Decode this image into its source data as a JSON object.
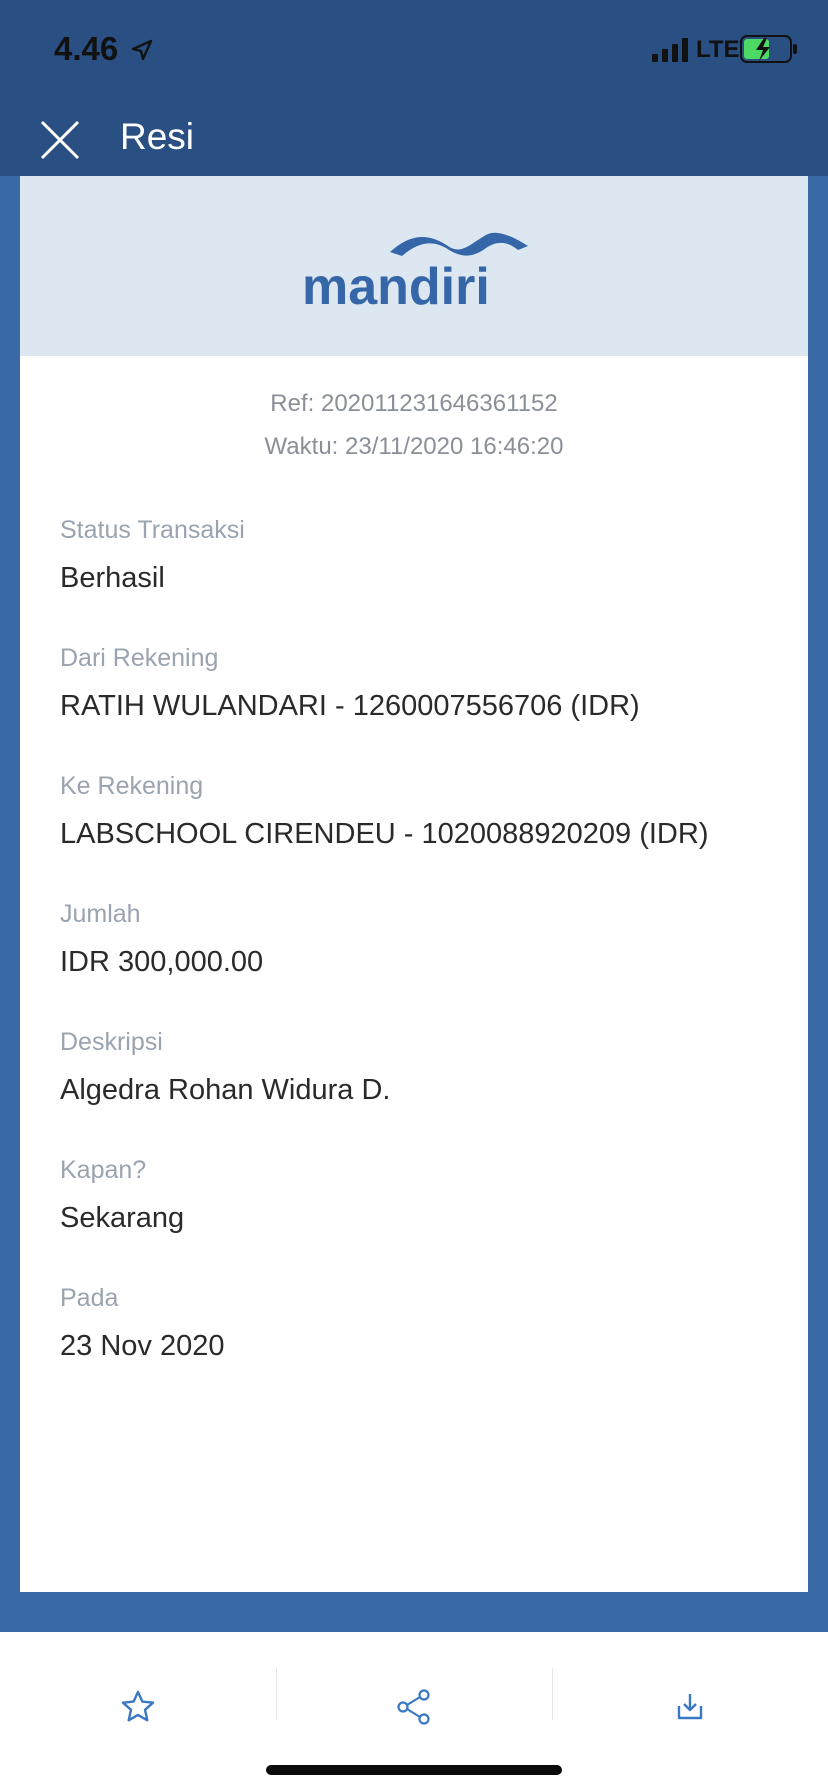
{
  "status_bar": {
    "time": "4.46",
    "network": "LTE",
    "icons": [
      "location-arrow-icon",
      "signal-icon",
      "battery-charging-icon"
    ]
  },
  "nav": {
    "title": "Resi",
    "close_icon": "close-icon"
  },
  "receipt": {
    "logo_text": "mandiri",
    "ref": "Ref: 202011231646361152",
    "time": "Waktu: 23/11/2020 16:46:20",
    "fields": [
      {
        "label": "Status Transaksi",
        "value": "Berhasil"
      },
      {
        "label": "Dari Rekening",
        "value": "RATIH WULANDARI - 1260007556706 (IDR)"
      },
      {
        "label": "Ke Rekening",
        "value": "LABSCHOOL CIRENDEU - 1020088920209 (IDR)"
      },
      {
        "label": "Jumlah",
        "value": "IDR 300,000.00"
      },
      {
        "label": "Deskripsi",
        "value": "Algedra Rohan Widura D."
      },
      {
        "label": "Kapan?",
        "value": "Sekarang"
      },
      {
        "label": "Pada",
        "value": "23 Nov 2020"
      }
    ]
  },
  "bottom_actions": [
    {
      "icon": "star-icon"
    },
    {
      "icon": "share-icon"
    },
    {
      "icon": "download-icon"
    }
  ],
  "colors": {
    "header_blue": "#2a4f82",
    "background_blue": "#3a6aa6",
    "receipt_header": "#dde7f2",
    "icon_blue": "#3b78c4",
    "label_gray": "#9aa3b0",
    "value_dark": "#2a2a2a"
  }
}
